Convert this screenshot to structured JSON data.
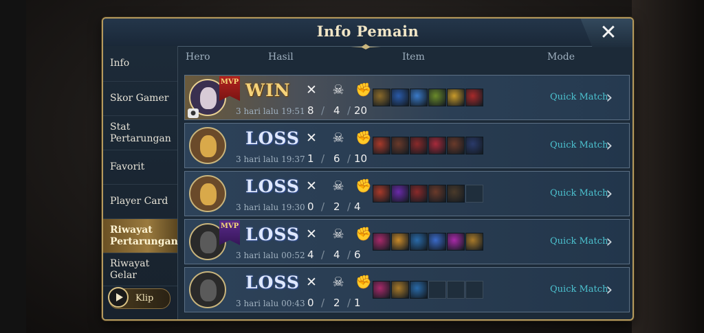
{
  "title": "Info Pemain",
  "sidebar": {
    "items": [
      {
        "label": "Info"
      },
      {
        "label": "Skor Gamer"
      },
      {
        "label": "Stat Pertarungan"
      },
      {
        "label": "Favorit"
      },
      {
        "label": "Player Card"
      },
      {
        "label": "Riwayat Pertarungan",
        "active": true
      },
      {
        "label": "Riwayat Gelar"
      }
    ],
    "clip_label": "Klip"
  },
  "columns": {
    "hero": "Hero",
    "result": "Hasil",
    "item": "Item",
    "mode": "Mode"
  },
  "matches": [
    {
      "result": "WIN",
      "time": "3 hari lalu 19:51",
      "kills": "8",
      "deaths": "4",
      "assists": "20",
      "mvp": true,
      "mvp_label": "MVP",
      "mode": "Quick Match",
      "items": [
        "#8a6a2a",
        "#2a5aa8",
        "#3a7ac8",
        "#6a8a2a",
        "#c89a2a",
        "#a82a2a"
      ]
    },
    {
      "result": "LOSS",
      "time": "3 hari lalu 19:37",
      "kills": "1",
      "deaths": "6",
      "assists": "10",
      "mvp": false,
      "mode": "Quick Match",
      "items": [
        "#a83a2a",
        "#6a3a2a",
        "#8a2a2a",
        "#a82a3a",
        "#6a3a2a",
        "#2a3a6a"
      ]
    },
    {
      "result": "LOSS",
      "time": "3 hari lalu 19:30",
      "kills": "0",
      "deaths": "2",
      "assists": "4",
      "mvp": false,
      "mode": "Quick Match",
      "items": [
        "#a83a2a",
        "#6a2aa8",
        "#8a2a2a",
        "#6a3a2a",
        "#4a3a2a",
        ""
      ]
    },
    {
      "result": "LOSS",
      "time": "3 hari lalu 00:52",
      "kills": "4",
      "deaths": "4",
      "assists": "6",
      "mvp": true,
      "mvp_label": "MVP",
      "mode": "Quick Match",
      "items": [
        "#a82a6a",
        "#c88a2a",
        "#2a6aa8",
        "#3a6ac8",
        "#a82aa8",
        "#a87a2a"
      ]
    },
    {
      "result": "LOSS",
      "time": "3 hari lalu 00:43",
      "kills": "0",
      "deaths": "2",
      "assists": "1",
      "mvp": false,
      "mode": "Quick Match",
      "items": [
        "#a82a6a",
        "#a87a2a",
        "#2a6aa8",
        "",
        "",
        ""
      ]
    }
  ]
}
